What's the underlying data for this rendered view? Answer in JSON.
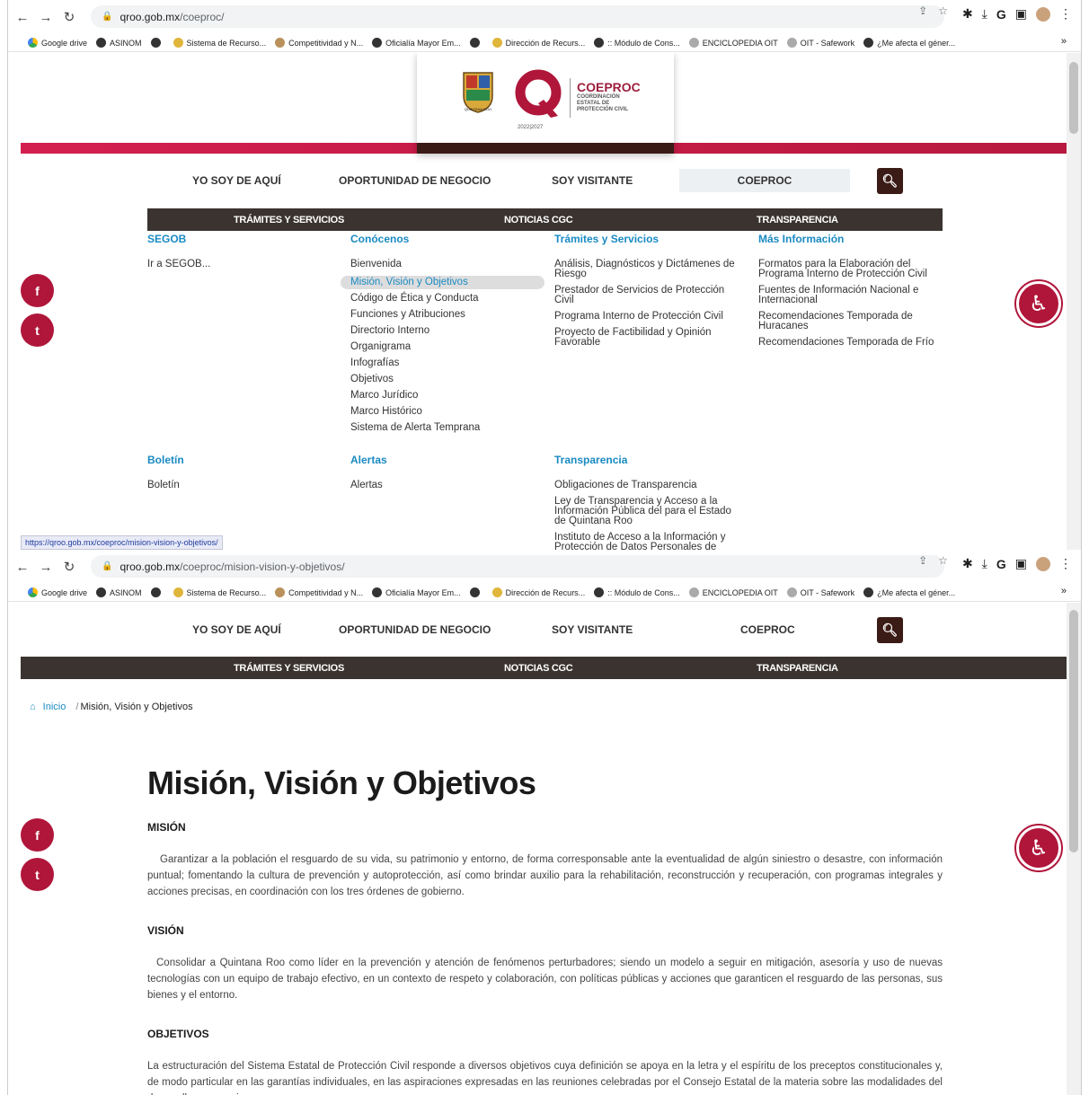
{
  "browser1": {
    "url_domain": "qroo.gob.mx",
    "url_path": "/coeproc/"
  },
  "browser2": {
    "url_domain": "qroo.gob.mx",
    "url_path": "/coeproc/mision-vision-y-objetivos/"
  },
  "bookmarks": [
    {
      "label": "Google drive",
      "icon": "drive-icon"
    },
    {
      "label": "ASINOM",
      "icon": "globe-icon"
    },
    {
      "label": "",
      "icon": "globe-icon"
    },
    {
      "label": "Sistema de Recurso...",
      "icon": "star-icon"
    },
    {
      "label": "Competitividad y N...",
      "icon": "circle-icon"
    },
    {
      "label": "Oficialía Mayor Em...",
      "icon": "globe-icon"
    },
    {
      "label": "",
      "icon": "globe-icon"
    },
    {
      "label": "Dirección de Recurs...",
      "icon": "building-icon"
    },
    {
      "label": ":: Módulo de Cons...",
      "icon": "globe-icon"
    },
    {
      "label": "ENCICLOPEDIA OIT",
      "icon": "oit-icon"
    },
    {
      "label": "OIT - Safework",
      "icon": "oit-icon"
    },
    {
      "label": "¿Me afecta el géner...",
      "icon": "globe-icon"
    }
  ],
  "bookmarks_more": "»",
  "logo": {
    "name": "COEPROC",
    "subtitle": "COORDINACIÓN ESTATAL DE PROTECCIÓN CIVIL",
    "shield_text": "QUINTANA ROO",
    "year": "2022|2027"
  },
  "nav": {
    "item1": "YO SOY DE AQUÍ",
    "item2": "OPORTUNIDAD DE NEGOCIO",
    "item3": "SOY VISITANTE",
    "search_value": "COEPROC"
  },
  "dark_nav": {
    "item1": "TRÁMITES Y SERVICIOS",
    "item2": "NOTICIAS CGC",
    "item3": "TRANSPARENCIA"
  },
  "mega": {
    "segob": {
      "title": "SEGOB",
      "items": [
        "Ir a SEGOB..."
      ]
    },
    "conocenos": {
      "title": "Conócenos",
      "items": [
        "Bienvenida",
        "Misión, Visión y Objetivos",
        "Código de Ética y Conducta",
        "Funciones y Atribuciones",
        "Directorio Interno",
        "Organigrama",
        "Infografías",
        "Objetivos",
        "Marco Jurídico",
        "Marco Histórico",
        "Sistema de Alerta Temprana"
      ]
    },
    "tramites": {
      "title": "Trámites y Servicios",
      "items": [
        "Análisis, Diagnósticos y Dictámenes de Riesgo",
        "Prestador de Servicios de Protección Civil",
        "Programa Interno de Protección Civil",
        "Proyecto de Factibilidad y Opinión Favorable"
      ]
    },
    "mas": {
      "title": "Más Información",
      "items": [
        "Formatos para la Elaboración del Programa Interno de Protección Civil",
        "Fuentes de Información Nacional e Internacional",
        "Recomendaciones Temporada de Huracanes",
        "Recomendaciones Temporada de Frío"
      ]
    },
    "boletin": {
      "title": "Boletín",
      "items": [
        "Boletín"
      ]
    },
    "alertas": {
      "title": "Alertas",
      "items": [
        "Alertas"
      ]
    },
    "transparencia": {
      "title": "Transparencia",
      "items": [
        "Obligaciones de Transparencia",
        "Ley de Transparencia y Acceso a la Información Pública del para el Estado de Quintana Roo",
        "Instituto de Acceso a la Información y Protección de Datos Personales de"
      ]
    }
  },
  "status_url": "https://qroo.gob.mx/coeproc/mision-vision-y-objetivos/",
  "breadcrumb": {
    "home": "Inicio",
    "sep": "/",
    "current": "Misión, Visión y Objetivos"
  },
  "page": {
    "title": "Misión, Visión y Objetivos",
    "mision_h": "MISIÓN",
    "mision": "Garantizar a la población el resguardo de su vida, su patrimonio y entorno, de forma corresponsable ante la eventualidad de algún siniestro o desastre, con información puntual; fomentando la cultura de prevención y autoprotección, así como brindar auxilio para la rehabilitación, reconstrucción y recuperación, con programas integrales y acciones precisas, en coordinación con los tres órdenes de gobierno.",
    "vision_h": "VISIÓN",
    "vision": "Consolidar a Quintana Roo como líder en la prevención y atención de fenómenos perturbadores; siendo un modelo a seguir en mitigación, asesoría y uso de nuevas tecnologías con un equipo de trabajo efectivo, en un contexto de respeto y colaboración, con políticas públicas y acciones que garanticen el resguardo de las personas, sus bienes y el entorno.",
    "objetivos_h": "OBJETIVOS",
    "objetivos": "La estructuración del Sistema Estatal de Protección Civil responde a diversos objetivos cuya definición se apoya en la letra y el espíritu de los preceptos constitucionales y, de modo particular en las garantías individuales, en las aspiraciones expresadas en las reuniones celebradas por el Consejo Estatal de la materia sobre las modalidades del desarrollo que requieren"
  },
  "social": {
    "facebook": "f",
    "twitter": "t"
  },
  "colors": {
    "brand": "#b0163a",
    "dark": "#3a332f",
    "link": "#1a8ac2"
  }
}
